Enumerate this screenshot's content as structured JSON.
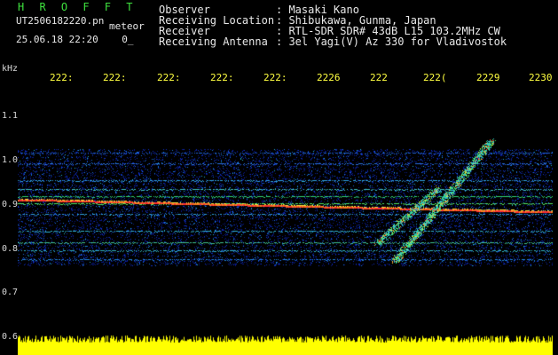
{
  "header": {
    "title": "H R O F F T",
    "filename": "UT2506182220.pn",
    "suffix": "meteor",
    "datetime": "25.06.18 22:20",
    "counter": "0_",
    "observer_label": "Observer",
    "observer_value": ": Masaki Kano",
    "location_label": "Receiving Location",
    "location_value": ": Shibukawa, Gunma, Japan",
    "receiver_label": "Receiver",
    "receiver_value": ": RTL-SDR SDR# 43dB L15 103.2MHz CW",
    "antenna_label": "Receiving Antenna",
    "antenna_value": ": 3el Yagi(V) Az 330 for Vladivostok"
  },
  "axis": {
    "unit": "kHz",
    "x_ticks": [
      "222:",
      "222:",
      "222:",
      "222:",
      "222:",
      "2226",
      "222",
      "222(",
      "2229",
      "2230"
    ],
    "y_ticks": [
      "1.1",
      "1.0",
      "0.9",
      "0.8",
      "0.7",
      "0.6"
    ]
  },
  "colors": {
    "header_title": "#3ee03e",
    "tick_color": "#ffff40",
    "signal_band": "#ff3030",
    "amplitude": "#ffff00"
  }
}
